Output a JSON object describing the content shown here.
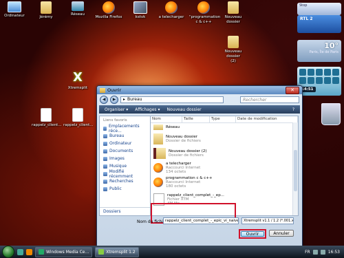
{
  "desktop": {
    "icons": [
      {
        "label": "Ordinateur",
        "icon": "computer-icon"
      },
      {
        "label": "Jérémy",
        "icon": "user-folder-icon"
      },
      {
        "label": "Réseau",
        "icon": "network-icon"
      },
      {
        "label": "Mozilla Firefox",
        "icon": "firefox-icon"
      },
      {
        "label": "kstvk",
        "icon": "photo-icon"
      },
      {
        "label": "a telecharger",
        "icon": "firefox-shortcut-icon"
      },
      {
        "label": "\"programmation c & c++",
        "icon": "firefox-shortcut-icon"
      },
      {
        "label": "Nouveau dossier",
        "icon": "folder-icon"
      },
      {
        "label": "Nouveau dossier\n(2)",
        "icon": "folder-icon"
      },
      {
        "label": "Xtremsplit",
        "icon": "xtremsplit-icon"
      },
      {
        "label": "rappelz_client...",
        "icon": "document-icon"
      },
      {
        "label": "rappelz_client...",
        "icon": "document-icon"
      }
    ]
  },
  "sidebar": {
    "tab_label": "Stop",
    "rtl_label": "RTL 2",
    "weather_temp": "10°",
    "weather_city": "Paris, Île de Paris",
    "clock_time": "14:51"
  },
  "dialog": {
    "title": "Ouvrir",
    "close_glyph": "✕",
    "back_glyph": "◀",
    "forward_glyph": "▶",
    "path": "Bureau",
    "path_sep": "▸",
    "search_placeholder": "Rechercher",
    "toolbar": {
      "organize": "Organiser ▾",
      "views": "Affichages ▾",
      "new_folder": "Nouveau dossier"
    },
    "left_pane": {
      "header": "Liens favoris",
      "links": [
        "Emplacements réce...",
        "Bureau",
        "Ordinateur",
        "Documents",
        "Images",
        "Musique",
        "Modifié récemment",
        "Recherches",
        "Public"
      ],
      "folders_label": "Dossiers"
    },
    "columns": [
      "Nom",
      "Taille",
      "Type",
      "Date de modification"
    ],
    "files": [
      {
        "name": "Réseau",
        "sub": "",
        "icon": "network-icon"
      },
      {
        "name": "Nouveau dossier",
        "sub": "Dossier de fichiers",
        "icon": "folder-icon"
      },
      {
        "name": "Nouveau dossier (2)",
        "sub": "Dossier de fichiers",
        "icon": "folder-icon"
      },
      {
        "name": "a telecharger",
        "sub": "Raccourci Internet\n134 octets",
        "icon": "firefox-icon"
      },
      {
        "name": "programmation c & c++",
        "sub": "Raccourci Internet\n180 octets",
        "icon": "firefox-icon"
      },
      {
        "name": "rappelz_client_complet_-_ep...",
        "sub": "Fichier XTM\n4M Mo",
        "icon": "file-icon"
      }
    ],
    "filename_label": "Nom du fichier :",
    "filename_value": "rappelz_client_complet_-_epic_vi_naive_...",
    "filetype_value": "Xtremsplit v1.1 / 1.2 (*.001.xtm)",
    "open_label": "Ouvrir",
    "cancel_label": "Annuler"
  },
  "taskbar": {
    "tasks": [
      {
        "label": "Windows Media Ce...",
        "icon": "media-center-icon"
      },
      {
        "label": "Xtremsplit 1.2",
        "icon": "xtremsplit-icon"
      }
    ],
    "lang": "FR",
    "clock": "16:53"
  }
}
